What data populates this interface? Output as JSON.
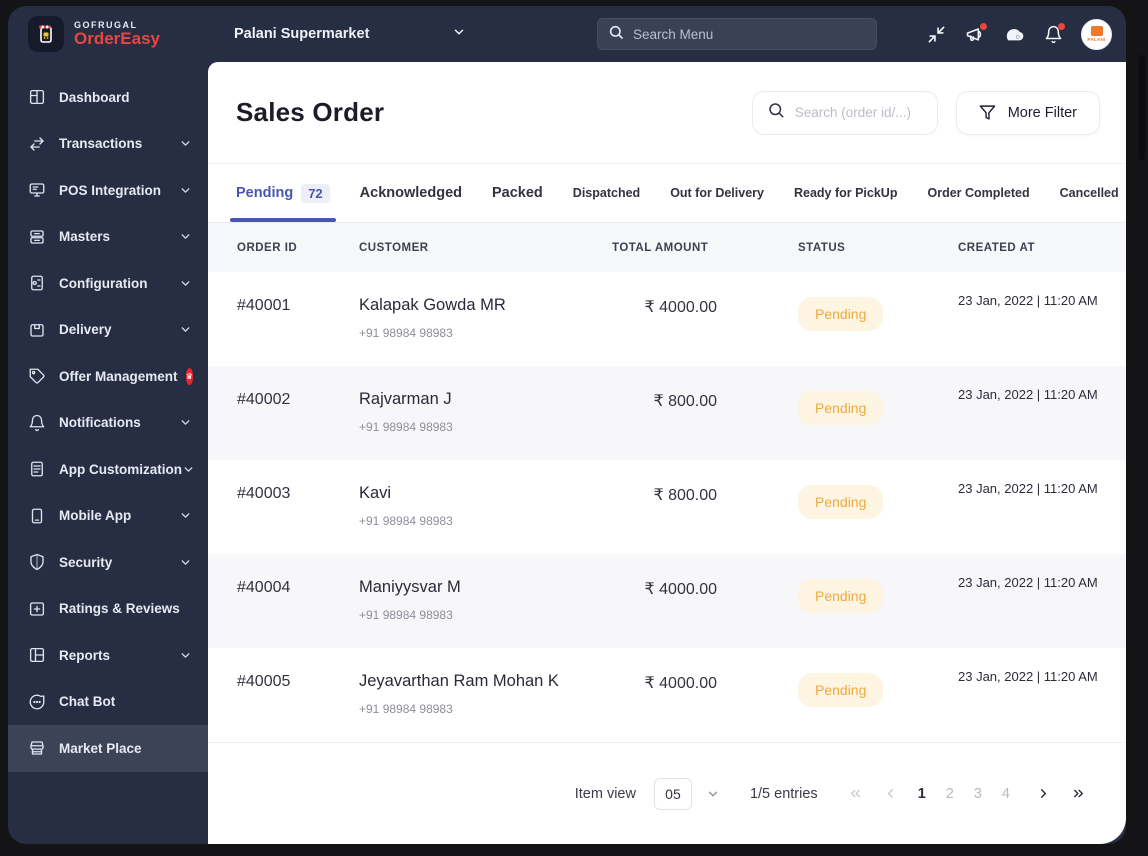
{
  "brand": {
    "company": "GOFRUGAL",
    "product": "OrderEasy"
  },
  "topbar": {
    "store_selector": "Palani Supermarket",
    "search_placeholder": "Search Menu",
    "icons": [
      "collapse-icon",
      "announcement-icon",
      "cloud-icon",
      "bell-icon"
    ],
    "avatar_store": "PALANI"
  },
  "sidebar": {
    "items": [
      {
        "label": "Dashboard",
        "icon": "dashboard",
        "chevron": false,
        "badge": false,
        "active": false
      },
      {
        "label": "Transactions",
        "icon": "transactions",
        "chevron": true,
        "badge": false,
        "active": false
      },
      {
        "label": "POS Integration",
        "icon": "pos-integration",
        "chevron": true,
        "badge": false,
        "active": false
      },
      {
        "label": "Masters",
        "icon": "masters",
        "chevron": true,
        "badge": false,
        "active": false
      },
      {
        "label": "Configuration",
        "icon": "configuration",
        "chevron": true,
        "badge": false,
        "active": false
      },
      {
        "label": "Delivery",
        "icon": "delivery",
        "chevron": true,
        "badge": false,
        "active": false
      },
      {
        "label": "Offer Management",
        "icon": "offer-tag",
        "chevron": false,
        "badge": true,
        "active": false
      },
      {
        "label": "Notifications",
        "icon": "notifications-bell",
        "chevron": true,
        "badge": false,
        "active": false
      },
      {
        "label": "App Customization",
        "icon": "app-customization",
        "chevron": true,
        "badge": false,
        "active": false
      },
      {
        "label": "Mobile App",
        "icon": "mobile-app",
        "chevron": true,
        "badge": false,
        "active": false
      },
      {
        "label": "Security",
        "icon": "security-shield",
        "chevron": true,
        "badge": false,
        "active": false
      },
      {
        "label": "Ratings & Reviews",
        "icon": "ratings-reviews",
        "chevron": false,
        "badge": false,
        "active": false
      },
      {
        "label": "Reports",
        "icon": "reports",
        "chevron": true,
        "badge": false,
        "active": false
      },
      {
        "label": "Chat Bot",
        "icon": "chat-bot",
        "chevron": false,
        "badge": false,
        "active": false
      },
      {
        "label": "Market Place",
        "icon": "market-place",
        "chevron": false,
        "badge": false,
        "active": true
      }
    ]
  },
  "page": {
    "title": "Sales Order",
    "search_placeholder": "Search (order id/...)",
    "filter_label": "More Filter"
  },
  "tabs": [
    {
      "label": "Pending",
      "count": "72",
      "active": true,
      "size": "lg"
    },
    {
      "label": "Acknowledged",
      "count": null,
      "active": false,
      "size": "lg"
    },
    {
      "label": "Packed",
      "count": null,
      "active": false,
      "size": "lg"
    },
    {
      "label": "Dispatched",
      "count": null,
      "active": false,
      "size": "sm"
    },
    {
      "label": "Out for Delivery",
      "count": null,
      "active": false,
      "size": "sm"
    },
    {
      "label": "Ready for PickUp",
      "count": null,
      "active": false,
      "size": "sm"
    },
    {
      "label": "Order Completed",
      "count": null,
      "active": false,
      "size": "sm"
    },
    {
      "label": "Cancelled",
      "count": null,
      "active": false,
      "size": "sm"
    }
  ],
  "table": {
    "columns": [
      "ORDER ID",
      "CUSTOMER",
      "TOTAL AMOUNT",
      "STATUS",
      "CREATED AT"
    ],
    "rows": [
      {
        "order_id": "#40001",
        "customer": "Kalapak Gowda MR",
        "phone": "+91 98984 98983",
        "amount": "₹ 4000.00",
        "status": "Pending",
        "created_at": "23 Jan, 2022 | 11:20 AM"
      },
      {
        "order_id": "#40002",
        "customer": "Rajvarman J",
        "phone": "+91 98984 98983",
        "amount": "₹ 800.00",
        "status": "Pending",
        "created_at": "23 Jan, 2022 | 11:20 AM"
      },
      {
        "order_id": "#40003",
        "customer": "Kavi",
        "phone": "+91 98984 98983",
        "amount": "₹ 800.00",
        "status": "Pending",
        "created_at": "23 Jan, 2022 | 11:20 AM"
      },
      {
        "order_id": "#40004",
        "customer": "Maniyysvar M",
        "phone": "+91 98984 98983",
        "amount": "₹ 4000.00",
        "status": "Pending",
        "created_at": "23 Jan, 2022 | 11:20 AM"
      },
      {
        "order_id": "#40005",
        "customer": "Jeyavarthan Ram Mohan K",
        "phone": "+91 98984 98983",
        "amount": "₹ 4000.00",
        "status": "Pending",
        "created_at": "23 Jan, 2022 | 11:20 AM"
      }
    ]
  },
  "footer": {
    "item_view_label": "Item view",
    "page_size": "05",
    "entries": "1/5 entries",
    "pages": [
      "1",
      "2",
      "3",
      "4"
    ],
    "current_page": "1"
  },
  "colors": {
    "sidebar_bg": "#272d42",
    "accent": "#4a55b2",
    "brand_red": "#e8473f",
    "pending_bg": "#fdf5e1",
    "pending_text": "#f0a93f",
    "selected_item_bg": "#3c4357"
  }
}
